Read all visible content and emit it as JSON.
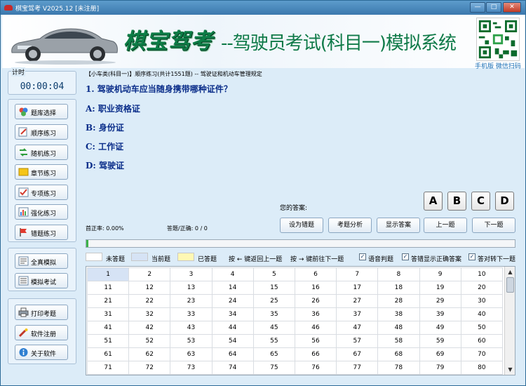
{
  "window": {
    "title": "棋宝驾考 V2025.12 [未注册]"
  },
  "banner": {
    "logo": "棋宝驾考",
    "slogan": "--驾驶员考试(科目一)模拟系统",
    "qr_caption": "手机版 微信扫码"
  },
  "timer": {
    "label": "计时",
    "value": "00:00:04"
  },
  "nav": {
    "group1": [
      {
        "label": "题库选择",
        "icon": "question-bank-icon"
      },
      {
        "label": "顺序练习",
        "icon": "sequence-icon"
      },
      {
        "label": "随机练习",
        "icon": "random-icon"
      },
      {
        "label": "章节练习",
        "icon": "chapter-icon"
      },
      {
        "label": "专项练习",
        "icon": "special-icon"
      },
      {
        "label": "强化练习",
        "icon": "reinforce-icon"
      },
      {
        "label": "错题练习",
        "icon": "wrong-flag-icon"
      }
    ],
    "group2": [
      {
        "label": "全真模拟",
        "icon": "simulation-icon"
      },
      {
        "label": "模拟考试",
        "icon": "exam-icon"
      }
    ],
    "group3": [
      {
        "label": "打印考题",
        "icon": "printer-icon"
      },
      {
        "label": "软件注册",
        "icon": "register-icon"
      },
      {
        "label": "关于软件",
        "icon": "info-icon"
      }
    ]
  },
  "breadcrumb": "【小车类(科目一)】顺序练习(共计1551题) -- 驾驶证和机动车管理规定",
  "question": {
    "text": "1. 驾驶机动车应当随身携带哪种证件？",
    "options": [
      "A: 职业资格证",
      "B: 身份证",
      "C: 工作证",
      "D: 驾驶证"
    ]
  },
  "answer": {
    "label": "您的答案:",
    "buttons": [
      "A",
      "B",
      "C",
      "D"
    ]
  },
  "stats": {
    "accuracy": "首正率: 0.00%",
    "answered": "答题/正确: 0 / 0"
  },
  "actions": [
    "设为错题",
    "考题分析",
    "显示答案",
    "上一题",
    "下一题"
  ],
  "progress": {
    "fraction": 0.005
  },
  "legend": {
    "unanswered": "未答题",
    "current": "当前题",
    "answered": "已答题",
    "hint_prev": "按 ← 键返回上一题",
    "hint_next": "按 → 键前往下一题",
    "check_voice": "语音判题",
    "check_show": "答错显示正确答案",
    "check_next": "答对转下一题"
  },
  "grid": {
    "rows": [
      [
        1,
        2,
        3,
        4,
        5,
        6,
        7,
        8,
        9,
        10
      ],
      [
        11,
        12,
        13,
        14,
        15,
        16,
        17,
        18,
        19,
        20
      ],
      [
        21,
        22,
        23,
        24,
        25,
        26,
        27,
        28,
        29,
        30
      ],
      [
        31,
        32,
        33,
        34,
        35,
        36,
        37,
        38,
        39,
        40
      ],
      [
        41,
        42,
        43,
        44,
        45,
        46,
        47,
        48,
        49,
        50
      ],
      [
        51,
        52,
        53,
        54,
        55,
        56,
        57,
        58,
        59,
        60
      ],
      [
        61,
        62,
        63,
        64,
        65,
        66,
        67,
        68,
        69,
        70
      ],
      [
        71,
        72,
        73,
        74,
        75,
        76,
        77,
        78,
        79,
        80
      ]
    ],
    "current": 1
  },
  "titlebar_buttons": {
    "minimize": "—",
    "maximize": "□",
    "close": "✕"
  }
}
